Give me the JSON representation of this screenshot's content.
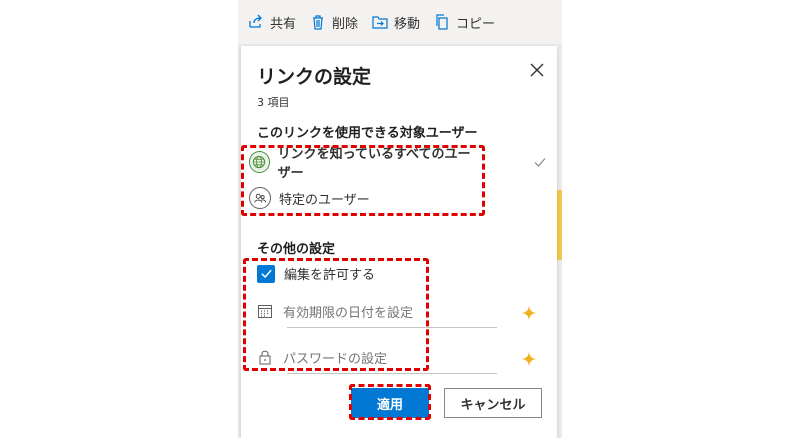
{
  "toolbar": {
    "share_label": "共有",
    "delete_label": "削除",
    "move_label": "移動",
    "copy_label": "コピー"
  },
  "panel": {
    "title": "リンクの設定",
    "item_count": "3 項目",
    "audience_heading": "このリンクを使用できる対象ユーザー",
    "audience_options": [
      {
        "label": "リンクを知っているすべてのユーザー",
        "icon": "globe-icon",
        "selected": true
      },
      {
        "label": "特定のユーザー",
        "icon": "people-icon",
        "selected": false
      }
    ],
    "other_heading": "その他の設定",
    "allow_edit_label": "編集を許可する",
    "allow_edit_checked": true,
    "expiry_placeholder": "有効期限の日付を設定",
    "password_placeholder": "パスワードの設定",
    "apply_label": "適用",
    "cancel_label": "キャンセル"
  },
  "colors": {
    "primary": "#0078d4",
    "highlight": "#e00000",
    "sparkle": "#f2b01e",
    "globe": "#4f8a3b"
  }
}
